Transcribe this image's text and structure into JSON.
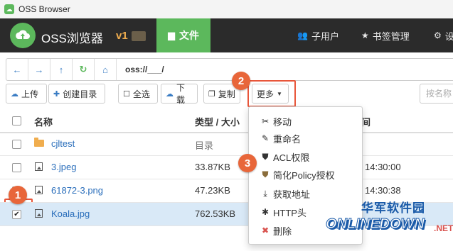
{
  "window": {
    "title": "OSS Browser"
  },
  "header": {
    "brand": "OSS浏览器",
    "version": "v1",
    "nav": {
      "files": "文件",
      "subusers": "子用户",
      "bookmarks": "书签管理",
      "settings": "设"
    }
  },
  "address": {
    "path": "oss://___/"
  },
  "toolbar": {
    "upload": "上传",
    "mkdir": "创建目录",
    "select_all": "全选",
    "download": "下载",
    "copy": "复制",
    "more": "更多",
    "search_placeholder": "按名称"
  },
  "table": {
    "headers": {
      "name": "名称",
      "type_size": "类型 / 大小",
      "time": "间"
    },
    "rows": [
      {
        "name": "cjltest",
        "size": "目录",
        "time": "",
        "kind": "folder",
        "checked": false
      },
      {
        "name": "3.jpeg",
        "size": "33.87KB",
        "time": "14:30:00",
        "kind": "image",
        "checked": false
      },
      {
        "name": "61872-3.png",
        "size": "47.23KB",
        "time": "14:30:38",
        "kind": "image",
        "checked": false
      },
      {
        "name": "Koala.jpg",
        "size": "762.53KB",
        "time": "",
        "kind": "image",
        "checked": true
      }
    ]
  },
  "more_menu": {
    "items": [
      {
        "label": "移动",
        "icon": "scissors-icon"
      },
      {
        "label": "重命名",
        "icon": "edit-icon"
      },
      {
        "label": "ACL权限",
        "icon": "shield-icon"
      },
      {
        "label": "简化Policy授权",
        "icon": "shield-icon"
      },
      {
        "label": "获取地址",
        "icon": "download-icon"
      },
      {
        "label": "HTTP头",
        "icon": "asterisk-icon"
      },
      {
        "label": "删除",
        "icon": "times-icon"
      }
    ]
  },
  "annotations": {
    "badge1": "1",
    "badge2": "2",
    "badge3": "3"
  },
  "watermark": {
    "cn": "华军软件园",
    "en": "ONLINEDOWN",
    "suffix": ".NET"
  },
  "colors": {
    "accent_green": "#5cb85c",
    "header_bg": "#2b2b2b",
    "highlight_red": "#e8563a",
    "link_blue": "#2a6ebb"
  }
}
